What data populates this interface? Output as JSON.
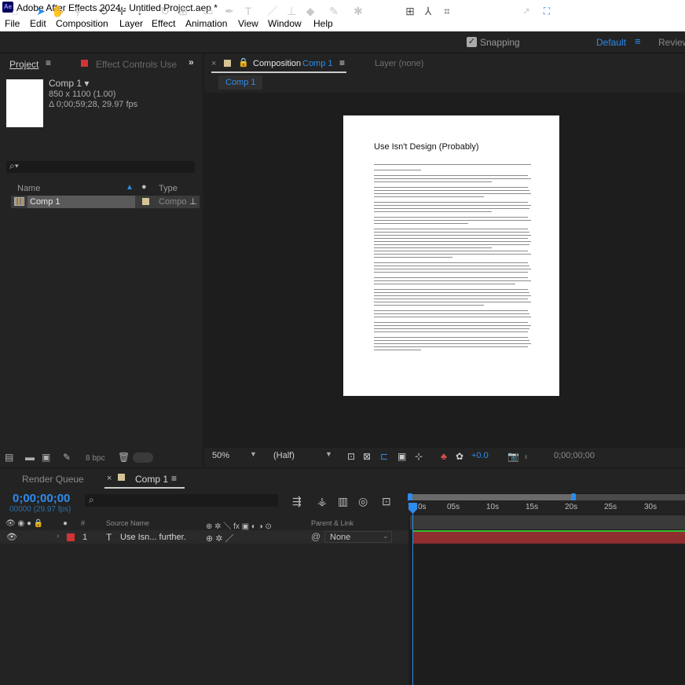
{
  "app": {
    "title": "Adobe After Effects 2024 - Untitled Project.aep *",
    "logo": "Ae"
  },
  "menu": [
    "File",
    "Edit",
    "Composition",
    "Layer",
    "Effect",
    "Animation",
    "View",
    "Window",
    "Help"
  ],
  "toolbar": {
    "snapping_label": "Snapping",
    "workspace": "Default",
    "workspace_menu": "≡",
    "review_label": "Review"
  },
  "project_panel": {
    "tab": "Project",
    "menu_icon": "≡",
    "effect_controls_tab": "Effect Controls Use",
    "more": "»",
    "item_name": "Comp 1 ▾",
    "item_dims": "850 x 1100 (1.00)",
    "item_duration": "Δ 0;00;59;28, 29.97 fps",
    "search_icon": "⌕▾",
    "col_name": "Name",
    "col_type": "Type",
    "rows": [
      {
        "name": "Comp 1",
        "type": "Compo"
      }
    ],
    "bpc": "8 bpc"
  },
  "composition_panel": {
    "close": "×",
    "tab_prefix": "Composition",
    "tab_name": "Comp 1",
    "menu_icon": "≡",
    "layer_tab": "Layer  (none)",
    "breadcrumb": "Comp 1",
    "zoom": "50%",
    "resolution": "(Half)",
    "exposure": "+0.0",
    "timecode": "0;00;00;00"
  },
  "document": {
    "title": "Use Isn't Design (Probably)"
  },
  "timeline": {
    "render_queue_tab": "Render Queue",
    "close": "×",
    "tab": "Comp 1",
    "menu_icon": "≡",
    "timecode": "0;00;00;00",
    "fps": "00000 (29.97 fps)",
    "col_number": "#",
    "col_source": "Source Name",
    "col_parent": "Parent & Link",
    "ruler": [
      "0s",
      "05s",
      "10s",
      "15s",
      "20s",
      "25s",
      "30s"
    ],
    "layer": {
      "number": "1",
      "type_icon": "T",
      "name": "Use Isn... further.",
      "parent": "None"
    }
  },
  "colors": {
    "accent": "#2d8ceb",
    "label_red": "#d13434",
    "label_sand": "#d6c496",
    "layer_bar": "#8e2e2e"
  }
}
